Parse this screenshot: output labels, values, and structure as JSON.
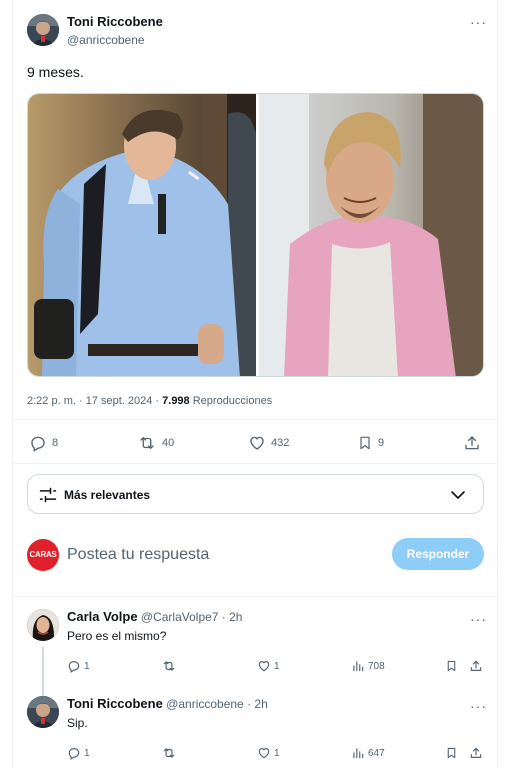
{
  "tweet": {
    "author_name": "Toni Riccobene",
    "author_handle": "@anriccobene",
    "more": "···",
    "text": "9 meses.",
    "time": "2:22 p. m. · 17 sept. 2024 · ",
    "views": "7.998",
    "views_label": " Reproducciones",
    "stats": {
      "replies": "8",
      "retweets": "40",
      "likes": "432",
      "bookmarks": "9"
    }
  },
  "sort": {
    "label": "Más relevantes"
  },
  "reply_box": {
    "avatar_text": "CARAS",
    "placeholder": "Postea tu respuesta",
    "button": "Responder"
  },
  "replies": [
    {
      "name": "Carla Volpe",
      "handle": "@CarlaVolpe7 · 2h",
      "text": "Pero es el mismo?",
      "replies": "1",
      "likes": "1",
      "views": "708"
    },
    {
      "name": "Toni Riccobene",
      "handle": "@anriccobene · 2h",
      "text": "Sip.",
      "replies": "1",
      "likes": "1",
      "views": "647"
    }
  ],
  "colors": {
    "accent": "#1d9bf0",
    "reply_button": "#8ecdf8",
    "brand_caras": "#e0202a",
    "text_secondary": "#536471"
  },
  "icons": [
    "reply-icon",
    "retweet-icon",
    "like-icon",
    "bookmark-icon",
    "share-icon",
    "views-icon",
    "filter-icon",
    "chevron-down-icon"
  ]
}
